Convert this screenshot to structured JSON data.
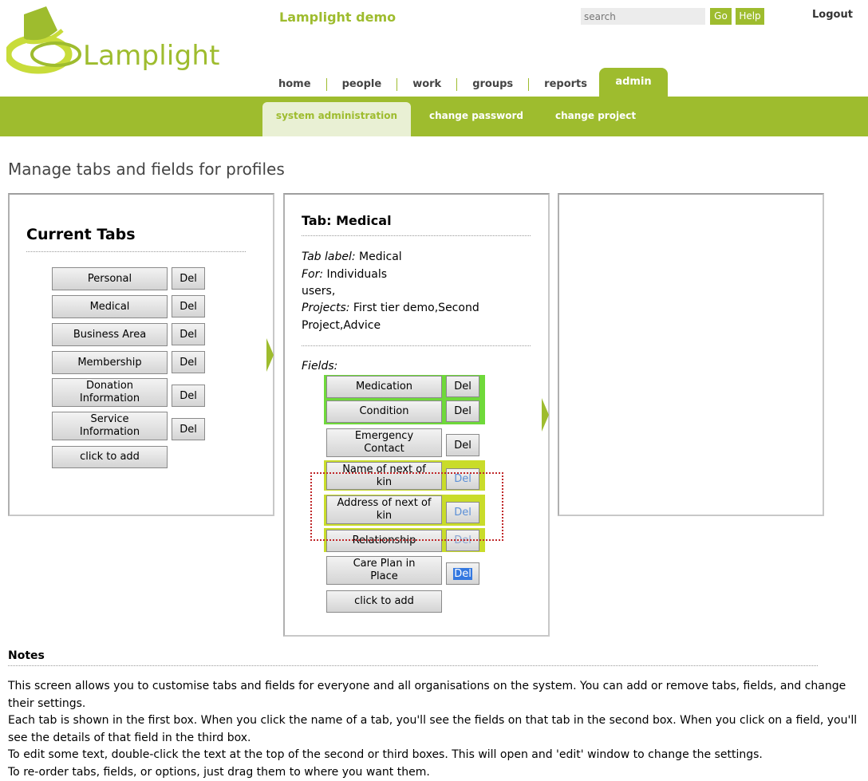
{
  "header": {
    "project_title": "Lamplight demo",
    "logo_text": "Lamplight",
    "search_placeholder": "search",
    "go_label": "Go",
    "help_label": "Help",
    "logout_label": "Logout"
  },
  "nav": {
    "items": [
      "home",
      "people",
      "work",
      "groups",
      "reports"
    ],
    "active": "admin"
  },
  "subnav": {
    "active": "system administration",
    "items": [
      "change password",
      "change project"
    ]
  },
  "page_title": "Manage tabs and fields for profiles",
  "current_tabs": {
    "heading": "Current Tabs",
    "tabs": [
      "Personal",
      "Medical",
      "Business Area",
      "Membership",
      "Donation Information",
      "Service Information"
    ],
    "del_label": "Del",
    "add_label": "click to add"
  },
  "tab_detail": {
    "heading": "Tab: Medical",
    "label_key": "Tab label:",
    "label_val": "Medical",
    "for_key": "For:",
    "for_val": "Individuals",
    "for_val2": "users,",
    "projects_key": "Projects:",
    "projects_val": "First tier demo,Second",
    "projects_val2": "Project,Advice",
    "fields_label": "Fields:",
    "fields": [
      "Medication",
      "Condition",
      "Emergency Contact",
      "Name of next of kin",
      "Address of next of kin",
      "Relationship",
      "Care Plan in Place"
    ],
    "del_label": "Del",
    "add_label": "click to add"
  },
  "notes": {
    "heading": "Notes",
    "lines": [
      "This screen allows you to customise tabs and fields for everyone and all organisations on the system. You can add or remove tabs, fields, and change their settings.",
      "Each tab is shown in the first box. When you click the name of a tab, you'll see the fields on that tab in the second box. When you click on a field, you'll see the details of that field in the third box.",
      "To edit some text, double-click the text at the top of the second or third boxes. This will open and 'edit' window to change the settings.",
      "To re-order tabs, fields, or options, just drag them to where you want them."
    ]
  },
  "colors": {
    "brand_green": "#9ebc2e",
    "highlight_green": "#6fd93a",
    "highlight_yellow": "#c9dc2a",
    "selection_blue": "#3478e0"
  },
  "icons": [
    "lamp-logo-icon",
    "arrow-right-icon"
  ]
}
